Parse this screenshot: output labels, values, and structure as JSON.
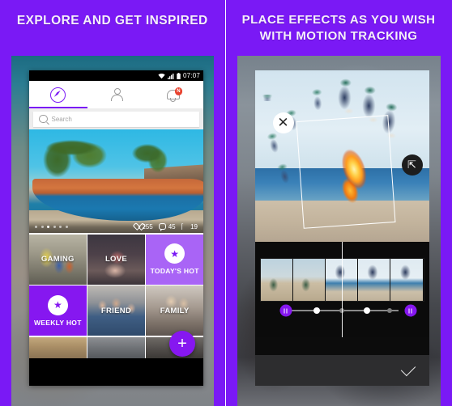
{
  "theme": {
    "brand_purple": "#7A19F5",
    "tile_purple": "#A964F6",
    "tile_purple_dark": "#8617F0",
    "badge_red": "#E8422E",
    "divider": "#FFFFFF"
  },
  "panels": [
    {
      "title": "EXPLORE AND GET INSPIRED",
      "phone": {
        "status_bar": {
          "time": "07:07",
          "icons": [
            "wifi-icon",
            "signal-icon",
            "battery-icon"
          ]
        },
        "tabs": [
          {
            "name": "explore",
            "icon": "compass-icon",
            "active": true
          },
          {
            "name": "profile",
            "icon": "person-icon",
            "active": false
          },
          {
            "name": "notifications",
            "icon": "notification-icon",
            "active": false,
            "badge": "N"
          }
        ],
        "search": {
          "placeholder": "Search",
          "icon": "search-icon",
          "value": ""
        },
        "feature_card": {
          "carousel_dots": 6,
          "active_dot_index": 2,
          "stats": [
            {
              "icon": "heart-icon",
              "value": "255"
            },
            {
              "icon": "comment-icon",
              "value": "45"
            },
            {
              "icon": "play-icon",
              "value": "19"
            }
          ]
        },
        "grid": [
          {
            "label": "GAMING",
            "style": "photo",
            "photo": "ph-gaming"
          },
          {
            "label": "LOVE",
            "style": "photo",
            "photo": "ph-love"
          },
          {
            "label": "TODAY'S HOT",
            "style": "hot",
            "icon": "star-icon"
          },
          {
            "label": "WEEKLY HOT",
            "style": "hot-weekly",
            "icon": "star-icon"
          },
          {
            "label": "FRIEND",
            "style": "photo",
            "photo": "ph-friend"
          },
          {
            "label": "FAMILY",
            "style": "photo",
            "photo": "ph-family"
          }
        ],
        "fab": {
          "label": "+",
          "icon": "plus-icon"
        }
      }
    },
    {
      "title_line1": "PLACE EFFECTS AS YOU WISH",
      "title_line2": "WITH MOTION TRACKING",
      "phone": {
        "canvas": {
          "delete_handle": {
            "icon": "close-icon",
            "label": "✕"
          },
          "rotate_handle": {
            "icon": "rotate-resize-icon",
            "label": "⤡"
          },
          "effect": "fire-flame-effect"
        },
        "timeline": {
          "keyframes": [
            {
              "type": "purple-handle",
              "icon": "pause-icon"
            },
            {
              "type": "white"
            },
            {
              "type": "gray"
            },
            {
              "type": "white"
            },
            {
              "type": "gray"
            },
            {
              "type": "purple-handle",
              "icon": "pause-icon"
            }
          ]
        },
        "bottom_bar": {
          "confirm": {
            "icon": "check-icon",
            "label": "✓"
          }
        }
      }
    }
  ]
}
